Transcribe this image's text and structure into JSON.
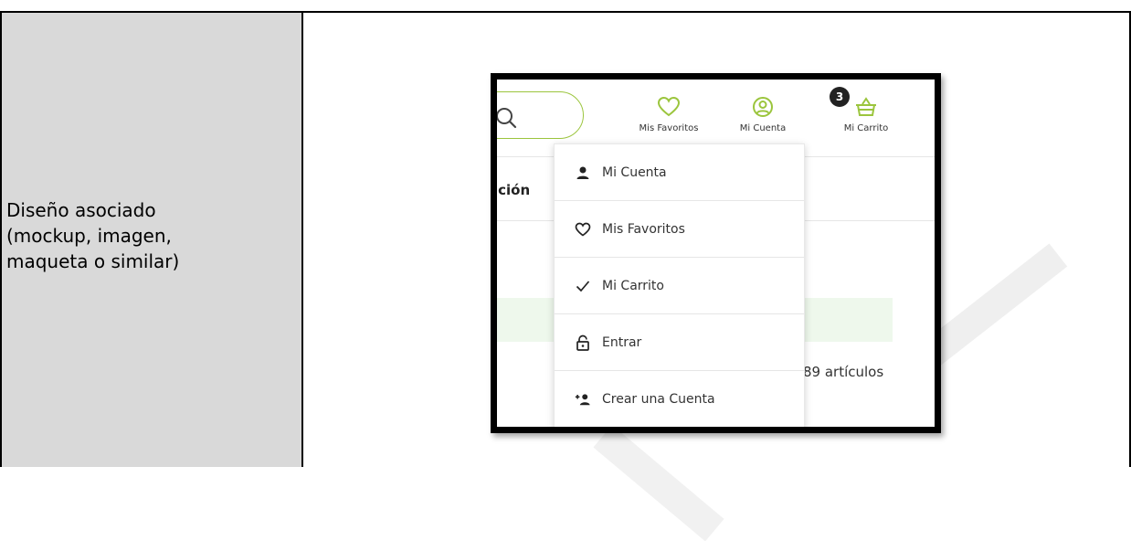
{
  "row": {
    "label": "Diseño asociado\n(mockup, imagen,\nmaqueta o similar)"
  },
  "mockup": {
    "header": {
      "favorites_label": "Mis Favoritos",
      "account_label": "Mi Cuenta",
      "cart_label": "Mi Carrito",
      "cart_count": "3"
    },
    "background": {
      "tab_fragment": "ición",
      "items_count": "89 artículos"
    },
    "accent_color": "#9bc53d",
    "dropdown": {
      "items": [
        {
          "label": "Mi Cuenta",
          "icon": "person-icon"
        },
        {
          "label": "Mis Favoritos",
          "icon": "heart-icon"
        },
        {
          "label": "Mi Carrito",
          "icon": "check-icon"
        },
        {
          "label": "Entrar",
          "icon": "lock-icon"
        },
        {
          "label": "Crear una Cuenta",
          "icon": "add-person-icon"
        }
      ]
    }
  }
}
